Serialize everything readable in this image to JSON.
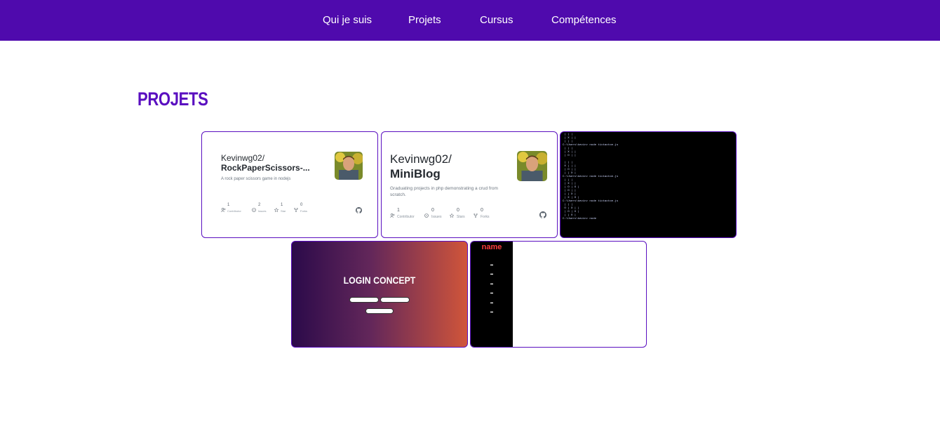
{
  "nav": {
    "items": [
      {
        "label": "Qui je suis"
      },
      {
        "label": "Projets"
      },
      {
        "label": "Cursus"
      },
      {
        "label": "Compétences"
      }
    ]
  },
  "section": {
    "title": "PROJETS"
  },
  "projects": [
    {
      "kind": "github-card",
      "owner": "Kevinwg02/",
      "repo": "RockPaperScissors-...",
      "description": "A rock paper scissors game in nodejs",
      "stats": [
        {
          "icon": "contributors-icon",
          "value": "1",
          "label": "Contributor"
        },
        {
          "icon": "issues-icon",
          "value": "2",
          "label": "Issues"
        },
        {
          "icon": "star-icon",
          "value": "1",
          "label": "Star"
        },
        {
          "icon": "fork-icon",
          "value": "0",
          "label": "Forks"
        }
      ]
    },
    {
      "kind": "github-card",
      "owner": "Kevinwg02/",
      "repo": "MiniBlog",
      "description": "Graduating projects in php demonstrating a crud from scratch.",
      "stats": [
        {
          "icon": "contributors-icon",
          "value": "1",
          "label": "Contributor"
        },
        {
          "icon": "issues-icon",
          "value": "0",
          "label": "Issues"
        },
        {
          "icon": "star-icon",
          "value": "0",
          "label": "Stars"
        },
        {
          "icon": "fork-icon",
          "value": "0",
          "label": "Forks"
        }
      ]
    },
    {
      "kind": "terminal-screenshot"
    },
    {
      "kind": "login-concept",
      "title": "LOGIN CONCEPT"
    },
    {
      "kind": "sidebar-concept",
      "title": "name"
    }
  ],
  "colors": {
    "nav_bg": "#4f0aad",
    "accent": "#5a0fc0",
    "sidebar_title": "#ff3d3d"
  }
}
